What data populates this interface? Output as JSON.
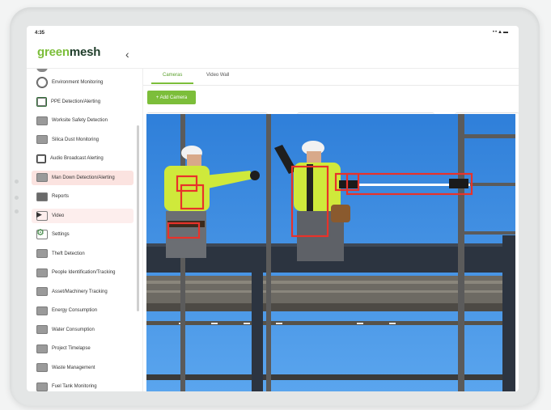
{
  "status_bar": {
    "time": "4:35",
    "icons": "••▲▬"
  },
  "app": {
    "logo_part1": "green",
    "logo_part2": "mesh",
    "collapse_glyph": "‹"
  },
  "sidebar": {
    "items": [
      {
        "label": "Environment Monitoring",
        "icon": "environment-icon"
      },
      {
        "label": "PPE Detection/Alerting",
        "icon": "ppe-icon"
      },
      {
        "label": "Worksite Safety Detection",
        "icon": "worksite-icon"
      },
      {
        "label": "Silica Dust Monitoring",
        "icon": "dust-icon"
      },
      {
        "label": "Audio Broadcast Alerting",
        "icon": "audio-icon"
      },
      {
        "label": "Man Down Detection/Alerting",
        "icon": "man-down-icon",
        "highlighted": true
      },
      {
        "label": "Reports",
        "icon": "reports-icon"
      },
      {
        "label": "Video",
        "icon": "video-icon",
        "active": true
      },
      {
        "label": "Settings",
        "icon": "settings-gear-icon"
      },
      {
        "label": "Theft Detection",
        "icon": "theft-icon"
      },
      {
        "label": "People Identification/Tracking",
        "icon": "people-icon"
      },
      {
        "label": "Asset/Machinery Tracking",
        "icon": "asset-icon"
      },
      {
        "label": "Energy Consumption",
        "icon": "energy-icon"
      },
      {
        "label": "Water Consumption",
        "icon": "water-icon"
      },
      {
        "label": "Project Timelapse",
        "icon": "timelapse-icon"
      },
      {
        "label": "Waste Management",
        "icon": "waste-icon"
      },
      {
        "label": "Fuel Tank Monitoring",
        "icon": "fuel-icon"
      }
    ]
  },
  "main": {
    "tabs": [
      {
        "label": "Cameras",
        "active": true
      },
      {
        "label": "Video Wall",
        "active": false
      }
    ],
    "add_camera_label": "+ Add Camera"
  },
  "colors": {
    "brand_green": "#7cbe3a",
    "brand_dark": "#1f3d2a",
    "detection_box": "#e8322a",
    "sky": "#3f8fe0"
  }
}
